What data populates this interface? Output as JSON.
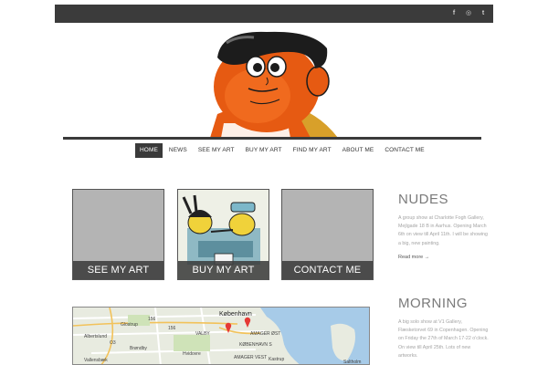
{
  "social": {
    "facebook": "f",
    "instagram": "◎",
    "tumblr": "t"
  },
  "nav": [
    "HOME",
    "NEWS",
    "SEE MY ART",
    "BUY MY ART",
    "FIND MY ART",
    "ABOUT ME",
    "CONTACT ME"
  ],
  "tiles": {
    "see": "SEE MY ART",
    "buy": "BUY MY ART",
    "contact": "CONTACT ME"
  },
  "map": {
    "labels": [
      "Glostrup",
      "Albertslund",
      "Brøndby",
      "Hvidovre",
      "Vallensbæk",
      "VALBY",
      "København",
      "AMAGER ØST",
      "KØBENHAVN S",
      "AMAGER VEST",
      "Kastrup",
      "Saltholm"
    ],
    "roads": [
      "156",
      "156",
      "O3"
    ]
  },
  "posts": [
    {
      "title": "NUDES",
      "text": "A group show at Charlotte Fogh Gallery, Mejlgade 18 B in Aarhus. Opening March 6th on view till April 11th. I will be showing a big, new painting.",
      "more": "Read more →"
    },
    {
      "title": "MORNING",
      "text": "A big solo show at V1 Gallery, Flæsketorvet 69 in Copenhagen. Opening on Friday the 27th of March 17-22 o'clock. On view till April 25th. Lots of new artworks."
    }
  ],
  "colors": {
    "topbar": "#3b3b3b",
    "character_skin": "#e65a12",
    "hair": "#1c1c1c",
    "pin": "#e53935"
  }
}
